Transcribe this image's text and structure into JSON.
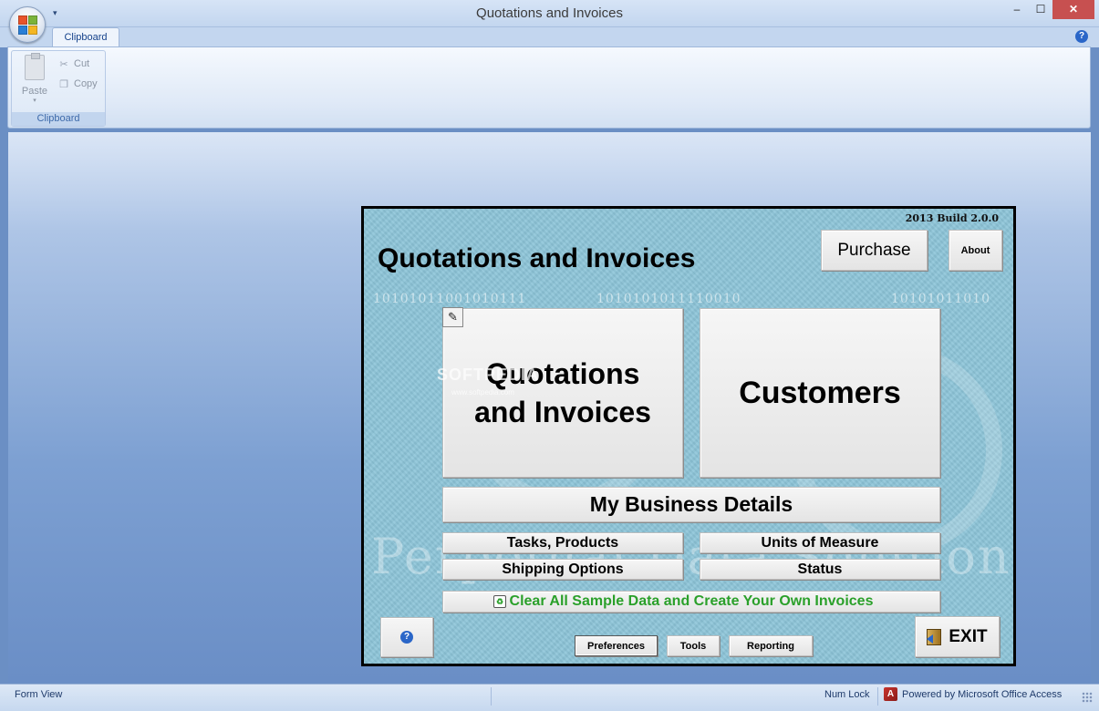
{
  "window": {
    "title": "Quotations and Invoices",
    "min": "–",
    "max": "☐",
    "close": "✕"
  },
  "ribbon": {
    "tab": "Clipboard",
    "group_label": "Clipboard",
    "paste_label": "Paste",
    "cut_label": "Cut",
    "copy_label": "Copy",
    "help": "?"
  },
  "form": {
    "build": "2013 Build 2.0.0",
    "title": "Quotations and Invoices",
    "purchase": "Purchase",
    "about": "About",
    "quotations_line1": "Quotations",
    "quotations_line2": "and Invoices",
    "customers": "Customers",
    "my_business": "My Business Details",
    "tasks_products": "Tasks, Products",
    "units_of_measure": "Units of Measure",
    "shipping_options": "Shipping Options",
    "status": "Status",
    "clear_sample": "Clear All Sample Data and Create Your Own Invoices",
    "help": "?",
    "preferences": "Preferences",
    "tools": "Tools",
    "reporting": "Reporting",
    "exit": "EXIT",
    "binary_1": "10101011001010111",
    "binary_2": "1010101011110010",
    "binary_3": "10101011010",
    "watermark": "Perpetual Data Solutions",
    "softpedia": "SOFTPEDIA",
    "softpedia_url": "www.softpedia.com"
  },
  "statusbar": {
    "left": "Form View",
    "num_lock": "Num Lock",
    "powered_by": "Powered by Microsoft Office Access"
  },
  "colors": {
    "accent": "#15428b",
    "form_bg": "#8cc4d8",
    "clear_text": "#2aa02a",
    "close_btn": "#c75050"
  },
  "icons": [
    "office-logo-icon",
    "cut-icon",
    "copy-icon",
    "paste-icon",
    "help-icon",
    "pencil-icon",
    "recycle-icon",
    "exit-door-icon",
    "access-icon",
    "resize-grip-icon"
  ]
}
